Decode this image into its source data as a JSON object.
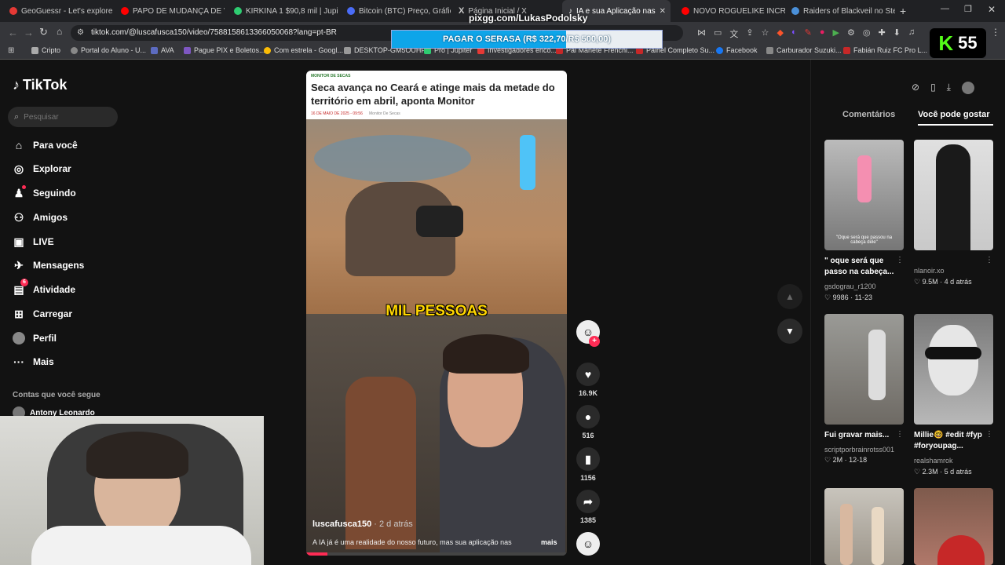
{
  "browser": {
    "tabs": [
      {
        "label": "GeoGuessr - Let's explore the",
        "color": "#e53935"
      },
      {
        "label": "PAPO DE MUDANÇA DE VIDA",
        "color": "#ff0000"
      },
      {
        "label": "KIRKINA 1 $90,8 mil | Jupiter",
        "color": "#2ecc71"
      },
      {
        "label": "Bitcoin (BTC) Preço, Gráfico, Ca",
        "color": "#4a6cf7"
      },
      {
        "label": "Página Inicial / X",
        "color": "#ffffff"
      },
      {
        "label": "IA e sua Aplicação nas",
        "color": "#111111"
      },
      {
        "label": "NOVO ROGUELIKE INCRÍVEL",
        "color": "#ff0000"
      },
      {
        "label": "Raiders of Blackveil no Steam",
        "color": "#1b2838"
      }
    ],
    "url": "tiktok.com/@luscafusca150/video/7588158613366050068?lang=pt-BR",
    "bookmarks": [
      {
        "label": "Cripto",
        "color": "#aaaaaa"
      },
      {
        "label": "Portal do Aluno - U...",
        "color": "#888888"
      },
      {
        "label": "AVA",
        "color": "#5c6bc0"
      },
      {
        "label": "Pague PIX e Boletos...",
        "color": "#7e57c2"
      },
      {
        "label": "Com estrela - Googl...",
        "color": "#fbbc05"
      },
      {
        "label": "DESKTOP-GM5OUHF",
        "color": "#999999"
      },
      {
        "label": "Pro | Jupiter",
        "color": "#2ecc71"
      },
      {
        "label": "Investigadores enco...",
        "color": "#e53935"
      },
      {
        "label": "Pai Manete Frenchi...",
        "color": "#c62828"
      },
      {
        "label": "Painel Completo Su...",
        "color": "#c62828"
      },
      {
        "label": "Facebook",
        "color": "#1877f2"
      },
      {
        "label": "Carburador Suzuki...",
        "color": "#888888"
      },
      {
        "label": "Fabián Ruiz FC Pro L...",
        "color": "#c62828"
      }
    ]
  },
  "overlay": {
    "pix_url": "pixgg.com/LukasPodolsky",
    "goal_text": "PAGAR O SERASA (R$ 322,70/R$ 500,00)",
    "goal_progress": 0.6454,
    "counter_letter": "K",
    "counter_value": "55"
  },
  "tiktok": {
    "logo": "TikTok",
    "search_placeholder": "Pesquisar",
    "nav": [
      {
        "label": "Para você",
        "icon": "home-icon"
      },
      {
        "label": "Explorar",
        "icon": "compass-icon"
      },
      {
        "label": "Seguindo",
        "icon": "following-icon"
      },
      {
        "label": "Amigos",
        "icon": "friends-icon"
      },
      {
        "label": "LIVE",
        "icon": "live-icon"
      },
      {
        "label": "Mensagens",
        "icon": "message-icon"
      },
      {
        "label": "Atividade",
        "icon": "activity-icon",
        "badge": "6"
      },
      {
        "label": "Carregar",
        "icon": "upload-icon"
      },
      {
        "label": "Perfil",
        "icon": "profile-icon"
      },
      {
        "label": "Mais",
        "icon": "more-icon"
      }
    ],
    "following_title": "Contas que você segue",
    "following_first": "Antony Leonardo",
    "video": {
      "news_tag": "MONITOR DE SECAS",
      "headline": "Seca avança no Ceará e atinge mais da metade do território em abril, aponta Monitor",
      "news_date": "16 DE MAIO DE 2025 - 09:56",
      "news_source": "Monitor De Secas",
      "caption": "MIL PESSOAS",
      "author": "luscafusca150",
      "age": "· 2 d atrás",
      "description": "A IA já é uma realidade do nosso futuro, mas sua aplicação nas",
      "more": "mais",
      "progress": 0.08
    },
    "actions": {
      "likes": "16.9K",
      "comments": "516",
      "saves": "1156",
      "shares": "1385"
    },
    "right_tabs": [
      "Comentários",
      "Você pode gostar"
    ],
    "recommendations": [
      {
        "title": "\" oque será que passo na cabeça...",
        "author": "gsdograu_r1200",
        "stats": "9986 · 11-23",
        "overlay": "\"Oque será que passou na cabeça dele\""
      },
      {
        "title": "",
        "author": "nlanoir.xo",
        "stats": "9.5M · 4 d atrás",
        "overlay": ""
      },
      {
        "title": "Fui gravar mais...",
        "author": "scriptporbrainrotss001",
        "stats": "2M · 12-18",
        "overlay": ""
      },
      {
        "title": "Millie🤓 #edit #fyp #foryoupag...",
        "author": "realshamrok",
        "stats": "2.3M · 5 d atrás",
        "overlay": ""
      },
      {
        "title": "",
        "author": "",
        "stats": "",
        "overlay": ""
      },
      {
        "title": "",
        "author": "",
        "stats": "",
        "overlay": ""
      }
    ]
  }
}
